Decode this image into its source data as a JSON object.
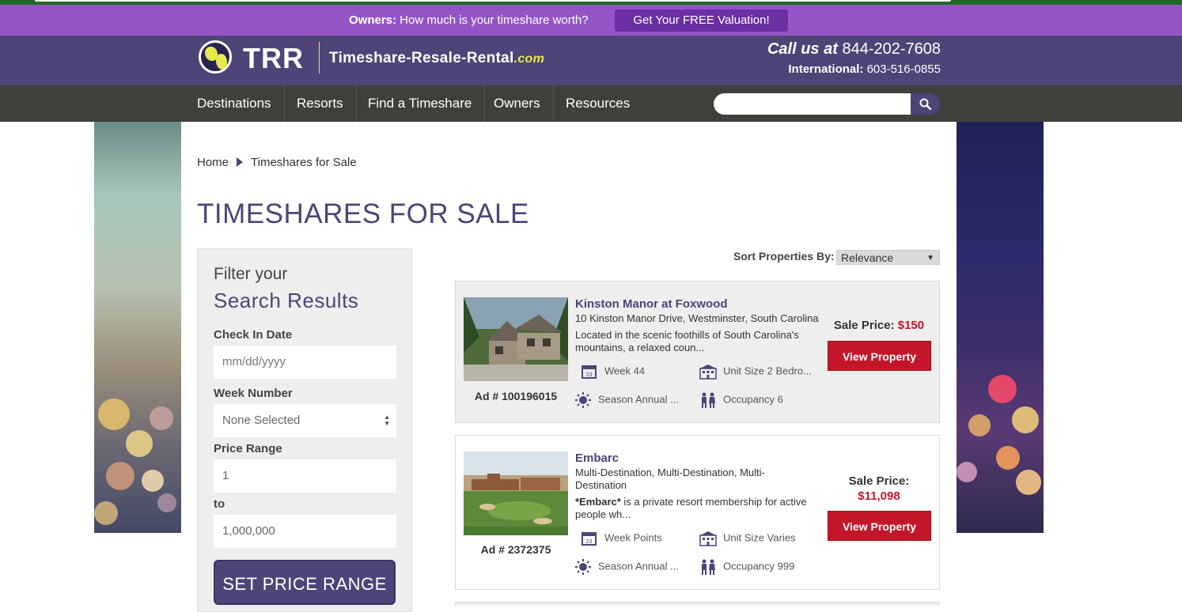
{
  "promo": {
    "owners_bold": "Owners:",
    "question": " How much is your timeshare worth?",
    "cta": "Get Your FREE Valuation!"
  },
  "header": {
    "logo_text": "TRR",
    "site_name": "Timeshare-Resale-Rental",
    "site_tld": ".com",
    "call_label": "Call us at",
    "call_number": " 844-202-7608",
    "intl_label": "International:",
    "intl_number": " 603-516-0855"
  },
  "nav": {
    "items": [
      "Destinations",
      "Resorts",
      "Find a Timeshare",
      "Owners",
      "Resources"
    ],
    "search_placeholder": ""
  },
  "breadcrumb": {
    "home": "Home",
    "current": "Timeshares for Sale"
  },
  "page_title": "TIMESHARES FOR SALE",
  "filter": {
    "title_line1": "Filter your",
    "title_line2": "Search Results",
    "check_in_label": "Check In Date",
    "check_in_placeholder": "mm/dd/yyyy",
    "week_label": "Week Number",
    "week_value": "None Selected",
    "price_label": "Price Range",
    "price_min": "1",
    "to_label": "to",
    "price_max": "1,000,000",
    "set_button": "SET PRICE RANGE"
  },
  "sort": {
    "label": "Sort Properties By:",
    "value": "Relevance"
  },
  "listings": [
    {
      "name": "Kinston Manor at Foxwood",
      "address": "10 Kinston Manor Drive, Westminster, South Carolina",
      "description": "Located in the scenic foothills of South Carolina's mountains, a relaxed coun...",
      "ad": "Ad # 100196015",
      "week": "Week 44",
      "unit": "Unit Size 2 Bedro...",
      "season": "Season Annual ...",
      "occupancy": "Occupancy 6",
      "price_label": "Sale Price:",
      "price": "$150",
      "button": "View Property"
    },
    {
      "name": "Embarc",
      "address": "Multi-Destination, Multi-Destination, Multi-Destination",
      "description": "*Embarc* is a private resort membership for active people wh...",
      "description_bold": "*Embarc*",
      "description_rest": " is a private resort membership for active people wh...",
      "ad": "Ad # 2372375",
      "week": "Week Points",
      "unit": "Unit Size Varies",
      "season": "Season Annual ...",
      "occupancy": "Occupancy 999",
      "price_label": "Sale Price:",
      "price": "$11,098",
      "button": "View Property"
    }
  ],
  "icons": {
    "calendar": "calendar-icon",
    "building": "building-icon",
    "sun": "sun-icon",
    "people": "people-icon",
    "search": "search-icon",
    "globe": "globe-icon"
  },
  "colors": {
    "brand_purple": "#4f4477",
    "promo_purple": "#9355c6",
    "nav_dark": "#3f403b",
    "accent_yellow": "#e6e94a",
    "price_red": "#c4162a"
  }
}
